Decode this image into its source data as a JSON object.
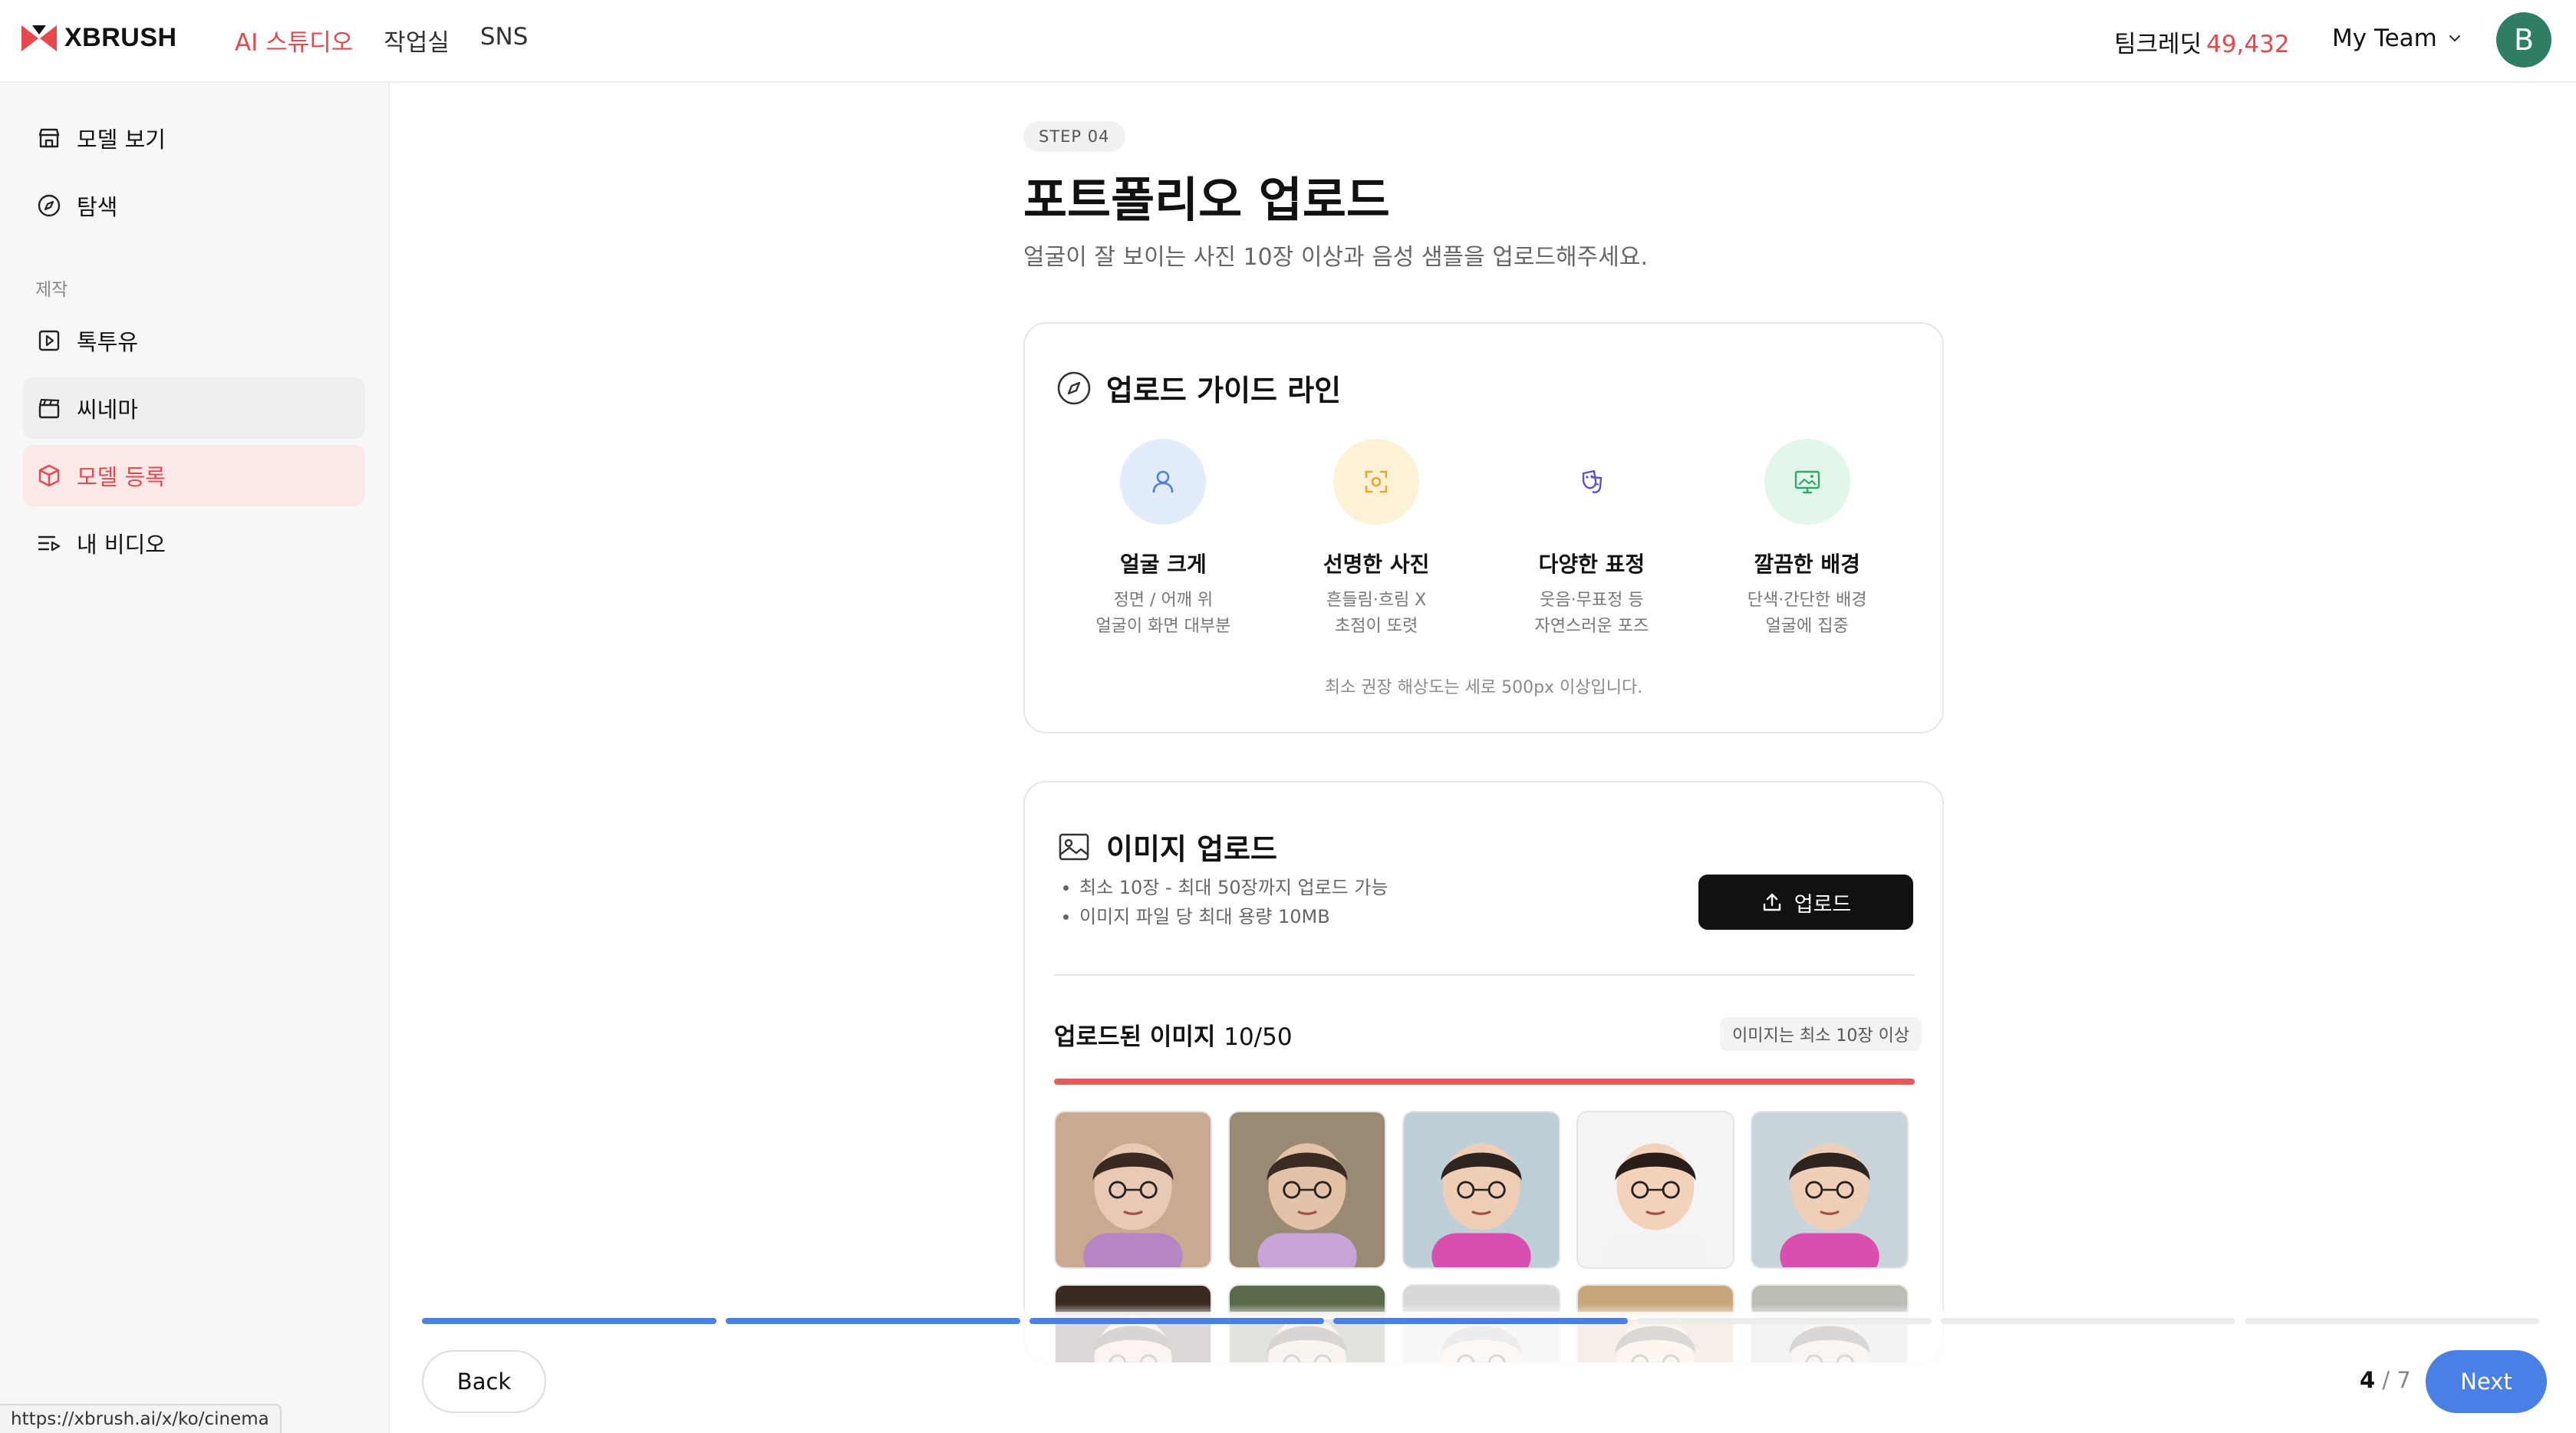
{
  "brand": {
    "name": "XBRUSH",
    "accent": "#e5484d"
  },
  "topnav": [
    {
      "label": "AI 스튜디오",
      "active": true
    },
    {
      "label": "작업실",
      "active": false
    },
    {
      "label": "SNS",
      "active": false
    }
  ],
  "header": {
    "credit_label": "팀크레딧",
    "credit_value": "49,432",
    "team_name": "My Team",
    "avatar_initial": "B"
  },
  "sidebar": {
    "items": [
      {
        "label": "모델 보기",
        "icon": "store-icon"
      },
      {
        "label": "탐색",
        "icon": "compass-icon"
      },
      {
        "label": "톡투유",
        "icon": "play-square-icon"
      },
      {
        "label": "씨네마",
        "icon": "clapperboard-icon"
      },
      {
        "label": "모델 등록",
        "icon": "box-icon",
        "active": true
      },
      {
        "label": "내 비디오",
        "icon": "video-list-icon"
      }
    ],
    "section_label": "제작"
  },
  "page": {
    "step_badge": "STEP 04",
    "title": "포트폴리오 업로드",
    "subtitle": "얼굴이 잘 보이는 사진 10장 이상과 음성 샘플을 업로드해주세요."
  },
  "guide": {
    "title": "업로드 가이드 라인",
    "items": [
      {
        "title": "얼굴 크게",
        "desc1": "정면 / 어깨 위",
        "desc2": "얼굴이 화면 대부분",
        "icon": "person-icon",
        "color": "#e3ecfb"
      },
      {
        "title": "선명한 사진",
        "desc1": "흔들림·흐림 X",
        "desc2": "초점이 또렷",
        "icon": "focus-icon",
        "color": "#fdf1d6"
      },
      {
        "title": "다양한 표정",
        "desc1": "웃음·무표정 등",
        "desc2": "자연스러운 포즈",
        "icon": "theater-masks-icon",
        "color": "#ffffff"
      },
      {
        "title": "깔끔한 배경",
        "desc1": "단색·간단한 배경",
        "desc2": "얼굴에 집중",
        "icon": "monitor-image-icon",
        "color": "#e2f6ea"
      }
    ],
    "note": "최소 권장 해상도는 세로 500px 이상입니다."
  },
  "upload": {
    "title": "이미지 업로드",
    "rules": [
      "최소 10장 - 최대 50장까지 업로드 가능",
      "이미지 파일 당 최대 용량 10MB"
    ],
    "button_label": "업로드",
    "uploaded_label": "업로드된 이미지",
    "uploaded_count": "10/50",
    "min_badge": "이미지는 최소 10장 이상",
    "progress_fraction": 1.0,
    "progress_color": "#e55a5a"
  },
  "footer": {
    "steps_total": 7,
    "steps_done": 4,
    "back_label": "Back",
    "next_label": "Next",
    "pager_current": "4",
    "pager_total": "/ 7",
    "step_color": "#4a7fe6"
  },
  "status_url": "https://xbrush.ai/x/ko/cinema"
}
